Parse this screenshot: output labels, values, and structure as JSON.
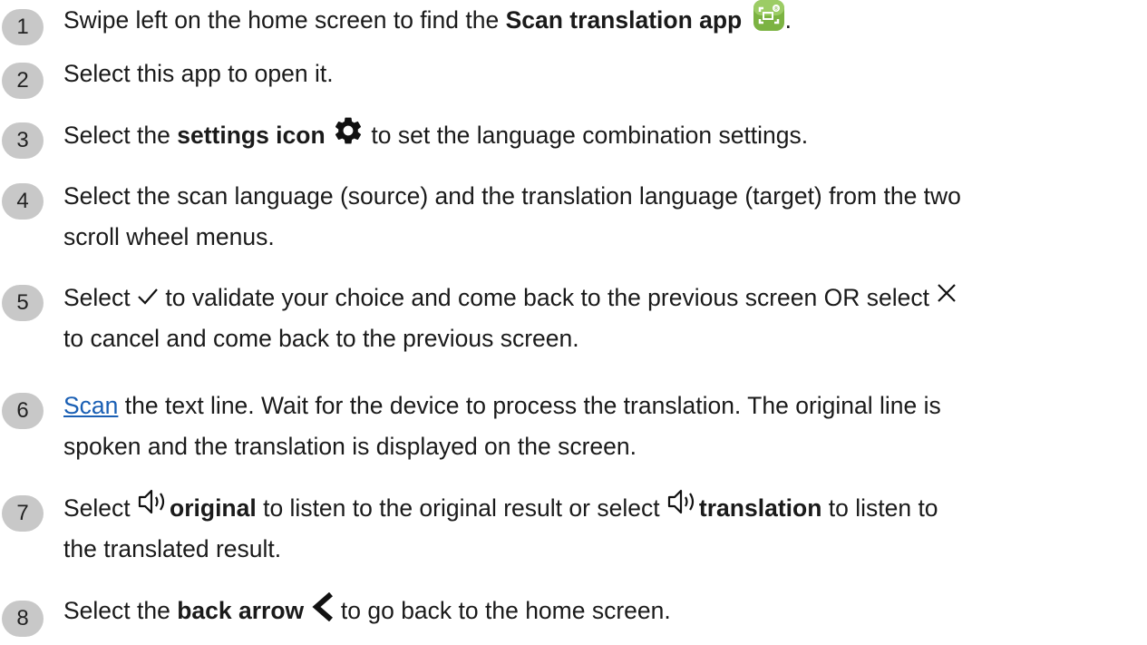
{
  "steps": [
    {
      "number": "1",
      "parts": {
        "a": "Swipe left on the home screen to find the ",
        "b": "Scan translation app",
        "c": "."
      },
      "icon": "scan-translation-app-icon"
    },
    {
      "number": "2",
      "parts": {
        "a": "Select this app to open it."
      }
    },
    {
      "number": "3",
      "parts": {
        "a": "Select the ",
        "b": "settings icon",
        "c": " to set the language combination settings."
      },
      "icon": "gear-icon"
    },
    {
      "number": "4",
      "lines": [
        "Select the scan language (source) and the translation language (target) from the two",
        "scroll wheel menus."
      ]
    },
    {
      "number": "5",
      "parts": {
        "a": "Select ",
        "b": " to validate your choice and come back to the previous screen OR select ",
        "c": " to cancel and come back to the previous screen."
      },
      "icons": [
        "checkmark-icon",
        "close-icon"
      ]
    },
    {
      "number": "6",
      "parts": {
        "link": "Scan",
        "a": " the text line. Wait for the device to process the translation. The original line is",
        "b": "spoken and the translation is displayed on the screen."
      }
    },
    {
      "number": "7",
      "parts": {
        "a": "Select ",
        "b": "original",
        "c": " to listen to the original result or select ",
        "d": "translation",
        "e": " to listen to",
        "f": "the translated result."
      },
      "icons": [
        "speaker-icon",
        "speaker-icon"
      ]
    },
    {
      "number": "8",
      "parts": {
        "a": "Select the ",
        "b": "back arrow",
        "c": " to go back to the home screen."
      },
      "icon": "back-arrow-icon"
    }
  ],
  "colors": {
    "badge": "#c8c8c8",
    "link": "#1a5fb4",
    "app_icon": "#7cb342"
  }
}
